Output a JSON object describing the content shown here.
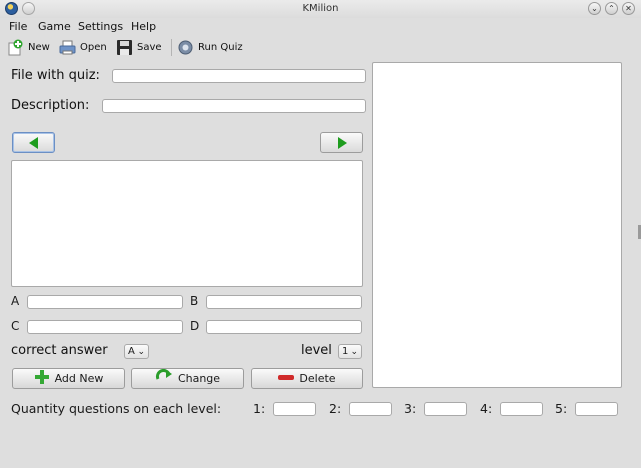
{
  "window": {
    "title": "KMilion"
  },
  "menu": {
    "items": [
      "File",
      "Game",
      "Settings",
      "Help"
    ]
  },
  "toolbar": {
    "new": "New",
    "open": "Open",
    "save": "Save",
    "run_quiz": "Run Quiz"
  },
  "form": {
    "file_label": "File with quiz:",
    "file_value": "",
    "description_label": "Description:",
    "description_value": "",
    "question_text": "",
    "answers": {
      "a_label": "A",
      "b_label": "B",
      "c_label": "C",
      "d_label": "D",
      "a_value": "",
      "b_value": "",
      "c_value": "",
      "d_value": ""
    },
    "correct_answer_label": "correct answer",
    "correct_answer_value": "A",
    "level_label": "level",
    "level_value": "1"
  },
  "buttons": {
    "add_new": "Add New",
    "change": "Change",
    "delete": "Delete"
  },
  "quantity": {
    "label": "Quantity questions on each level:",
    "levels": [
      "1:",
      "2:",
      "3:",
      "4:",
      "5:"
    ],
    "values": [
      "",
      "",
      "",
      "",
      ""
    ]
  },
  "icons": {
    "nav_prev": "left-arrow-icon",
    "nav_next": "right-arrow-icon",
    "new": "new-document-icon",
    "open": "open-printer-icon",
    "save": "floppy-disk-icon",
    "run": "gear-icon"
  },
  "colors": {
    "accent_green": "#1e9c1e",
    "delete_red": "#d02a2a",
    "background": "#dedede"
  }
}
